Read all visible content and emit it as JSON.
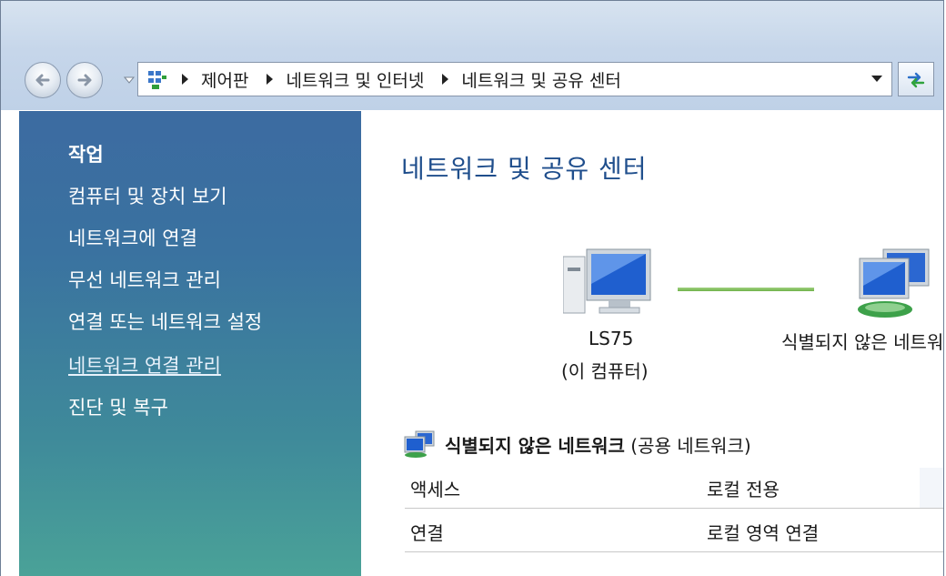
{
  "address_bar": {
    "breadcrumbs": [
      "제어판",
      "네트워크 및 인터넷",
      "네트워크 및 공유 센터"
    ]
  },
  "sidebar": {
    "title": "작업",
    "tasks": [
      {
        "label": "컴퓨터 및 장치 보기"
      },
      {
        "label": "네트워크에 연결"
      },
      {
        "label": "무선 네트워크 관리"
      },
      {
        "label": "연결 또는 네트워크 설정"
      },
      {
        "label": "네트워크 연결 관리"
      },
      {
        "label": "진단 및 복구"
      }
    ]
  },
  "main": {
    "title": "네트워크 및 공유 센터",
    "map": {
      "computer_name": "LS75",
      "computer_sub": "(이 컴퓨터)",
      "network_name": "식별되지 않은 네트워크"
    },
    "network": {
      "name": "식별되지 않은 네트워크",
      "type": "(공용 네트워크)",
      "rows": [
        {
          "label": "액세스",
          "value": "로컬 전용"
        },
        {
          "label": "연결",
          "value": "로컬 영역 연결"
        }
      ]
    }
  }
}
